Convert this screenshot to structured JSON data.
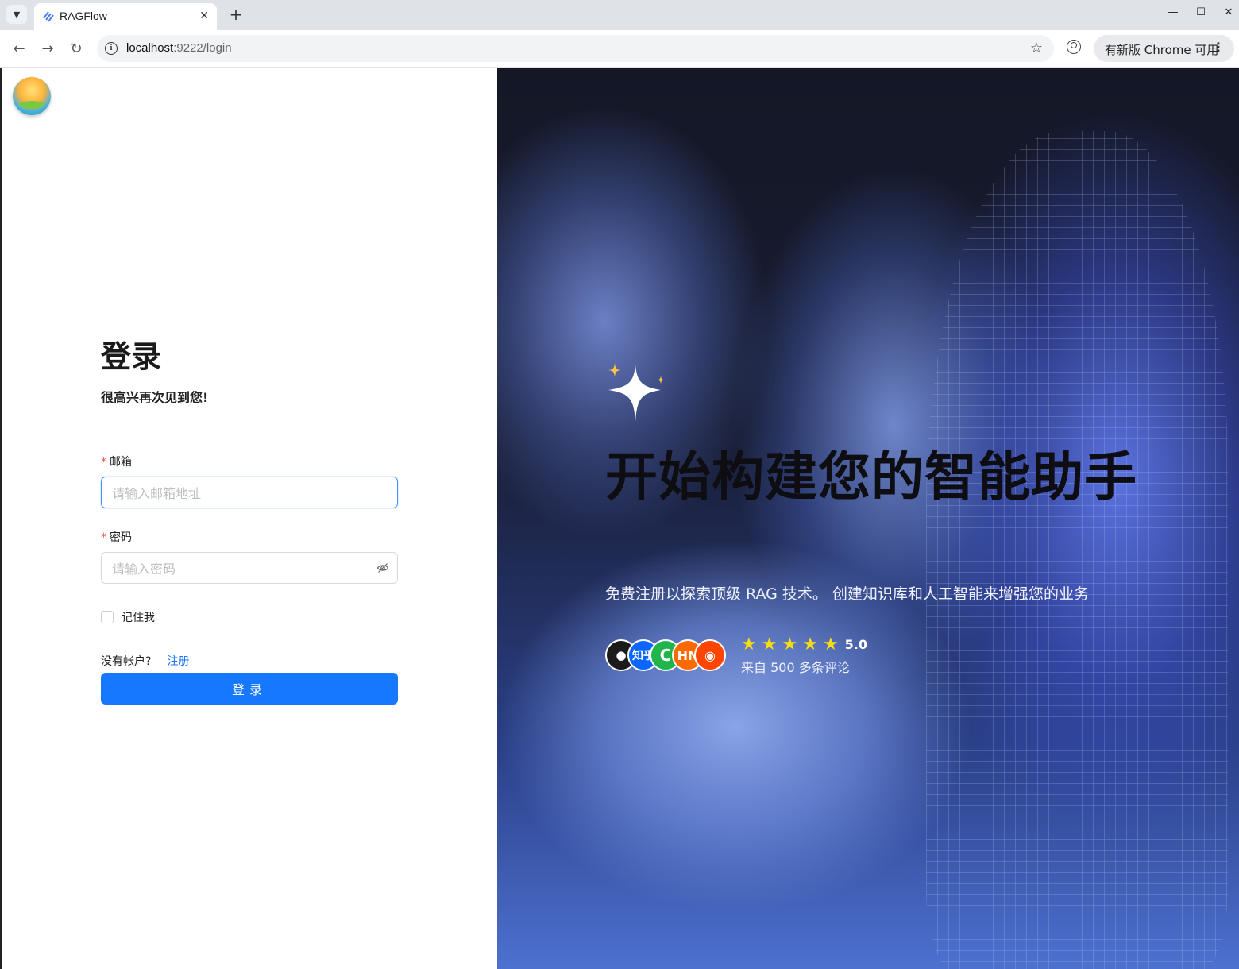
{
  "browser": {
    "tab_title": "RAGFlow",
    "tab_close": "✕",
    "new_tab": "+",
    "url_host": "localhost",
    "url_rest": ":9222/login",
    "update_label": "有新版 Chrome 可用"
  },
  "login": {
    "title": "登录",
    "subtitle": "很高兴再次见到您!",
    "email_label": "邮箱",
    "email_placeholder": "请输入邮箱地址",
    "password_label": "密码",
    "password_placeholder": "请输入密码",
    "remember_label": "记住我",
    "no_account_text": "没有帐户?",
    "signup_link": "注册",
    "submit_label": "登录"
  },
  "hero": {
    "headline": "开始构建您的智能助手",
    "description": "免费注册以探索顶级 RAG 技术。 创建知识库和人工智能来增强您的业务",
    "badges": [
      {
        "icon": "github-icon",
        "label": ""
      },
      {
        "icon": "zhihu-icon",
        "label": "知乎"
      },
      {
        "icon": "wechat-icon",
        "label": ""
      },
      {
        "icon": "hackernews-icon",
        "label": "HN"
      },
      {
        "icon": "reddit-icon",
        "label": ""
      }
    ],
    "rating_score": "5.0",
    "rating_stars": 5,
    "rating_count": "来自 500 多条评论"
  },
  "colors": {
    "primary": "#1677ff",
    "required_mark": "#ff4d4f",
    "star": "#fadb14"
  }
}
